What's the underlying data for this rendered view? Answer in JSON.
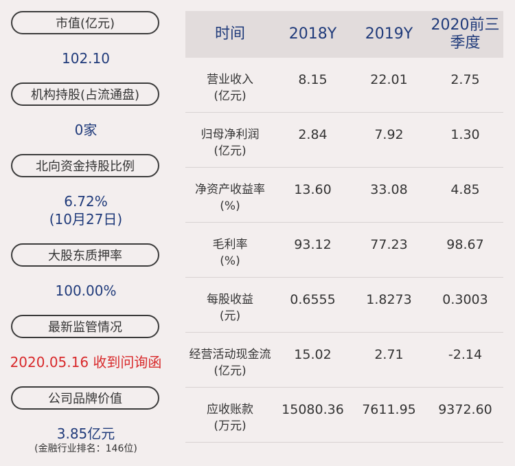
{
  "left": {
    "items": [
      {
        "label": "市值(亿元)",
        "value": "102.10"
      },
      {
        "label": "机构持股(占流通盘)",
        "value": "0家"
      },
      {
        "label": "北向资金持股比例",
        "value": "6.72%",
        "value2": "(10月27日)"
      },
      {
        "label": "大股东质押率",
        "value": "100.00%"
      },
      {
        "label": "最新监管情况",
        "value": "2020.05.16 收到问询函"
      },
      {
        "label": "公司品牌价值",
        "value": "3.85亿元",
        "note": "(金融行业排名：146位)"
      }
    ]
  },
  "table": {
    "headers": [
      "时间",
      "2018Y",
      "2019Y",
      "2020前三季度"
    ],
    "rows": [
      {
        "label1": "营业收入",
        "label2": "(亿元)",
        "values": [
          "8.15",
          "22.01",
          "2.75"
        ]
      },
      {
        "label1": "归母净利润",
        "label2": "(亿元)",
        "values": [
          "2.84",
          "7.92",
          "1.30"
        ]
      },
      {
        "label1": "净资产收益率",
        "label2": "(%)",
        "values": [
          "13.60",
          "33.08",
          "4.85"
        ]
      },
      {
        "label1": "毛利率",
        "label2": "(%)",
        "values": [
          "93.12",
          "77.23",
          "98.67"
        ]
      },
      {
        "label1": "每股收益",
        "label2": "(元)",
        "values": [
          "0.6555",
          "1.8273",
          "0.3003"
        ]
      },
      {
        "label1": "经营活动现金流",
        "label2": "(亿元)",
        "values": [
          "15.02",
          "2.71",
          "-2.14"
        ]
      },
      {
        "label1": "应收账款",
        "label2": "(万元)",
        "values": [
          "15080.36",
          "7611.95",
          "9372.60"
        ]
      }
    ]
  },
  "colors": {
    "background": "#f3eeee",
    "header_bg": "#e2dcdc",
    "value_blue": "#1f3a7a",
    "value_red": "#d8282a"
  }
}
